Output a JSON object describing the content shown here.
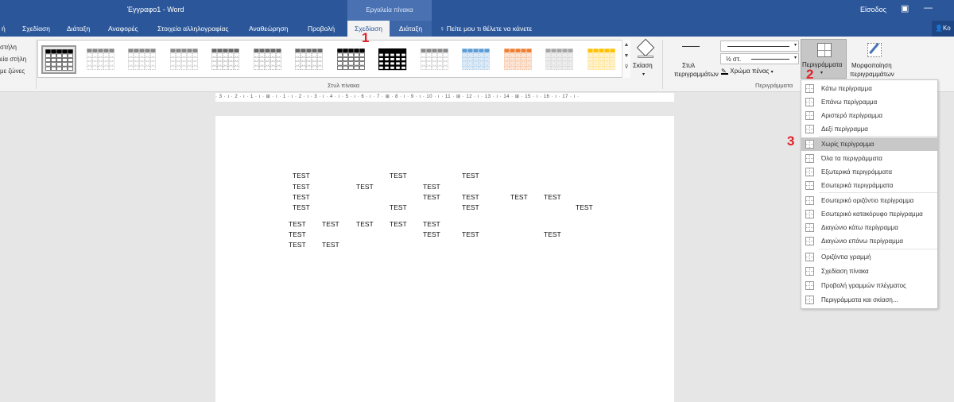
{
  "title_bar": {
    "doc_title": "Έγγραφο1 - Word",
    "context_title": "Εργαλεία πίνακα",
    "sign_in": "Είσοδος",
    "restore_icon": "restore-icon",
    "minimize_icon": "minimize-icon"
  },
  "tabs": [
    {
      "label": "ή"
    },
    {
      "label": "Σχεδίαση"
    },
    {
      "label": "Διάταξη"
    },
    {
      "label": "Αναφορές"
    },
    {
      "label": "Στοιχεία αλληλογραφίας"
    },
    {
      "label": "Αναθεώρηση"
    },
    {
      "label": "Προβολή"
    },
    {
      "label": "Σχεδίαση"
    },
    {
      "label": "Διάταξη"
    }
  ],
  "tell_me": "Πείτε μου τι θέλετε να κάνετε",
  "share_label": "Κο",
  "left_options": [
    "στήλη",
    "εία στήλη",
    "με ζώνες"
  ],
  "table_styles": {
    "group_label": "Στυλ πίνακα",
    "shading_label": "Σκίαση"
  },
  "borders_group": {
    "group_label": "Περιγράμματα",
    "border_styles_line1": "Στυλ",
    "border_styles_line2": "περιγραμμάτων",
    "width_value": "½ στ.",
    "pen_color_label": "Χρώμα πένας",
    "borders_label": "Περιγράμματα",
    "border_painter_line1": "Μορφοποίηση",
    "border_painter_line2": "περιγραμμάτων"
  },
  "ruler_text": "· 3 · ı · 2 · ı · 1 · ı · ⊞ · ı · 1 · ı · 2 · ı · 3 · ı · 4 · ı · 5 · ı · 6 · ı · 7 · ⊞ · 8 · ı · 9 · ı · 10 · ı · 11 · ⊞ · 12 · ı · 13 · ı · 14 · ⊞ · 15 · ı · 16 · ı · 17 · ı ·",
  "document_cell_text": "TEST",
  "annotations": [
    "1",
    "2",
    "3"
  ],
  "borders_menu": [
    {
      "label": "Κάτω περίγραμμα",
      "icon": "bottom-border-icon"
    },
    {
      "label": "Επάνω περίγραμμα",
      "icon": "top-border-icon"
    },
    {
      "label": "Αριστερό περίγραμμα",
      "icon": "left-border-icon"
    },
    {
      "label": "Δεξί περίγραμμα",
      "icon": "right-border-icon"
    },
    {
      "label": "Χωρίς περίγραμμα",
      "icon": "no-border-icon"
    },
    {
      "label": "Όλα τα περιγράμματα",
      "icon": "all-borders-icon"
    },
    {
      "label": "Εξωτερικά περιγράμματα",
      "icon": "outside-borders-icon"
    },
    {
      "label": "Εσωτερικά περιγράμματα",
      "icon": "inside-borders-icon"
    },
    {
      "label": "Εσωτερικό οριζόντιο περίγραμμα",
      "icon": "inside-horizontal-border-icon"
    },
    {
      "label": "Εσωτερικό κατακόρυφο περίγραμμα",
      "icon": "inside-vertical-border-icon"
    },
    {
      "label": "Διαγώνιο κάτω περίγραμμα",
      "icon": "diagonal-down-border-icon"
    },
    {
      "label": "Διαγώνιο επάνω περίγραμμα",
      "icon": "diagonal-up-border-icon"
    },
    {
      "label": "Οριζόντια γραμμή",
      "icon": "horizontal-line-icon"
    },
    {
      "label": "Σχεδίαση πίνακα",
      "icon": "draw-table-icon"
    },
    {
      "label": "Προβολή γραμμών πλέγματος",
      "icon": "view-gridlines-icon"
    },
    {
      "label": "Περιγράμματα και σκίαση...",
      "icon": "borders-and-shading-icon"
    }
  ],
  "menu_highlighted_index": 4
}
